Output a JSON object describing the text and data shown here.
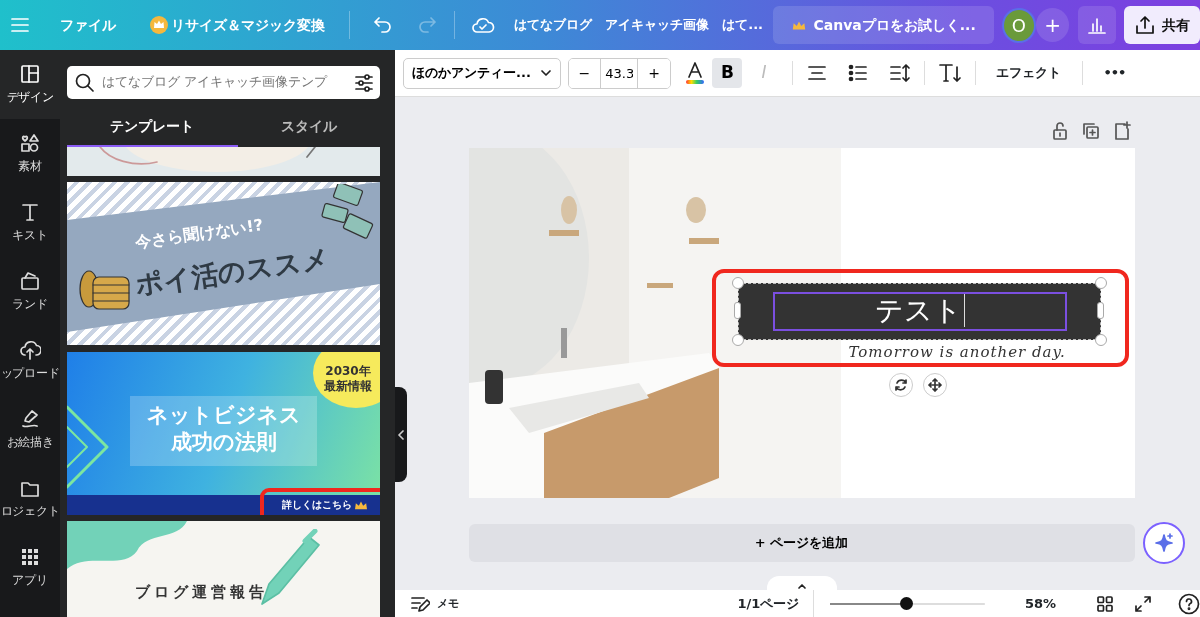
{
  "header": {
    "file_menu": "ファイル",
    "resize_button": "リサイズ＆マジック変換",
    "history_buttons": [
      {
        "kind": "undo",
        "disabled": false
      },
      {
        "kind": "redo",
        "disabled": true
      }
    ],
    "document_title": "はてなブログ　アイキャッチ画像　はて...",
    "pro_trial_button": "Canvaプロをお試しく...",
    "avatar_initial": "O",
    "add_glyph": "+",
    "share_button": "共有"
  },
  "sidebar": {
    "items": [
      {
        "kind": "design",
        "label": "デザイン",
        "selected": true
      },
      {
        "kind": "elements",
        "label": "素材",
        "selected": false
      },
      {
        "kind": "text",
        "label": "キスト",
        "selected": false
      },
      {
        "kind": "brand",
        "label": "ランド",
        "selected": false
      },
      {
        "kind": "upload",
        "label": "ップロード",
        "selected": false
      },
      {
        "kind": "draw",
        "label": "お絵描き",
        "selected": false
      },
      {
        "kind": "projects",
        "label": "ロジェクト",
        "selected": false
      },
      {
        "kind": "apps",
        "label": "アプリ",
        "selected": false
      }
    ]
  },
  "panel": {
    "search": {
      "placeholder": "はてなブログ アイキャッチ画像テンプ"
    },
    "tabs": [
      {
        "label": "テンプレート",
        "selected": true
      },
      {
        "label": "スタイル",
        "selected": false
      }
    ],
    "templates": [
      {
        "kind": "sketch"
      },
      {
        "kind": "banner",
        "lines": [
          "今さら聞けない!?",
          "ポイ活のススメ"
        ]
      },
      {
        "kind": "gradient",
        "badge_lines": [
          "2030年",
          "最新情報"
        ],
        "lines": [
          "ネットビジネス",
          "成功の法則"
        ],
        "link_label": "詳しくはこちら",
        "premium": true
      },
      {
        "kind": "memo",
        "lines": [
          "ブログ運営報告"
        ]
      }
    ]
  },
  "toolbar": {
    "font": "ほのかアンティー...",
    "decrease_glyph": "−",
    "font_size": "43.3",
    "increase_glyph": "+",
    "format_buttons": [
      {
        "kind": "bold",
        "glyph": "B",
        "selected": true,
        "disabled": false
      },
      {
        "kind": "italic",
        "glyph": "I",
        "selected": false,
        "disabled": true
      }
    ],
    "effects_button": "エフェクト",
    "more_glyph": "•••"
  },
  "canvas": {
    "text_box": "テスト",
    "script_text": "Tomorrow is another day.",
    "add_page_button": "+ ページを追加"
  },
  "footer": {
    "notes_button": "メモ",
    "page_indicator": "1/1ページ",
    "zoom": {
      "level": 0.49
    },
    "zoom_reading": "58%"
  }
}
